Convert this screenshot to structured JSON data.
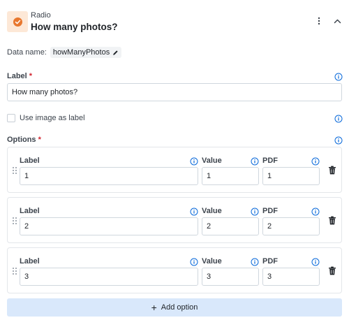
{
  "header": {
    "type_label": "Radio",
    "title": "How many photos?",
    "menu_icon": "kebab-menu-icon",
    "collapse_icon": "chevron-up-icon"
  },
  "data_name": {
    "label": "Data name:",
    "value": "howManyPhotos",
    "edit_icon": "pencil-icon"
  },
  "label_field": {
    "label": "Label",
    "required_mark": "*",
    "value": "How many photos?"
  },
  "image_label": {
    "label": "Use image as label",
    "checked": false
  },
  "options_section": {
    "label": "Options",
    "required_mark": "*",
    "column_labels": {
      "label": "Label",
      "value": "Value",
      "pdf": "PDF"
    },
    "items": [
      {
        "label": "1",
        "value": "1",
        "pdf": "1"
      },
      {
        "label": "2",
        "value": "2",
        "pdf": "2"
      },
      {
        "label": "3",
        "value": "3",
        "pdf": "3"
      }
    ]
  },
  "add_option": {
    "label": "Add option"
  },
  "colors": {
    "accent_orange": "#e8772e",
    "accent_orange_bg": "#fde8d7",
    "add_button_bg": "#d9e8fb",
    "required_red": "#d1242f",
    "info_blue": "#0969da"
  }
}
